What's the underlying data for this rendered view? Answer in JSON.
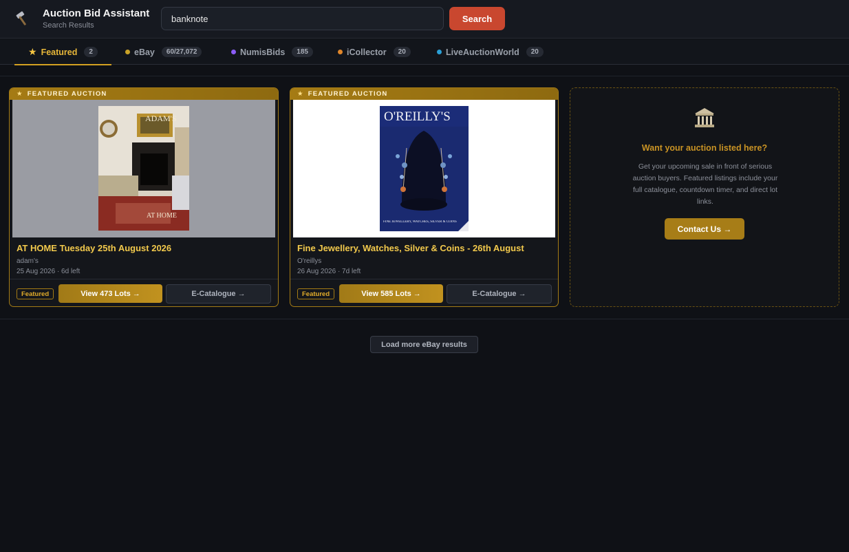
{
  "header": {
    "logo_icon": "hammer-icon",
    "title": "Auction Bid Assistant",
    "subtitle": "Search Results",
    "search_value": "banknote",
    "search_button": "Search"
  },
  "tabs": [
    {
      "label": "Featured",
      "count": "2",
      "icon": "star-icon",
      "active": true
    },
    {
      "label": "eBay",
      "count": "60/27,072",
      "dot_color": "#c9a227"
    },
    {
      "label": "NumisBids",
      "count": "185",
      "dot_color": "#8b5cf6"
    },
    {
      "label": "iCollector",
      "count": "20",
      "dot_color": "#e0862a"
    },
    {
      "label": "LiveAuctionWorld",
      "count": "20",
      "dot_color": "#2a9fd6"
    }
  ],
  "cards": [
    {
      "banner": "FEATURED AUCTION",
      "cover_text": "ADAM'S",
      "cover_footer": "AT HOME",
      "title": "AT HOME Tuesday 25th August 2026",
      "seller": "adam's",
      "meta": "25 Aug 2026 · 6d left",
      "badge": "Featured",
      "view_button": "View 473 Lots →",
      "ecatalogue_button": "E-Catalogue →"
    },
    {
      "banner": "FEATURED AUCTION",
      "cover_text": "O'REILLY'S",
      "cover_footer": "FINE JEWELLERY, WATCHES, SILVER & COINS",
      "title": "Fine Jewellery, Watches, Silver & Coins - 26th August",
      "seller": "O'reillys",
      "meta": "26 Aug 2026 · 7d left",
      "badge": "Featured",
      "view_button": "View 585 Lots →",
      "ecatalogue_button": "E-Catalogue →"
    }
  ],
  "promo": {
    "icon": "bank-building-icon",
    "title": "Want your auction listed here?",
    "text": "Get your upcoming sale in front of serious auction buyers. Featured listings include your full catalogue, countdown timer, and direct lot links.",
    "button": "Contact Us →"
  },
  "load_more": "Load more eBay results",
  "colors": {
    "accent": "#d4a121",
    "search_button": "#c9472f",
    "background": "#0f1116"
  }
}
